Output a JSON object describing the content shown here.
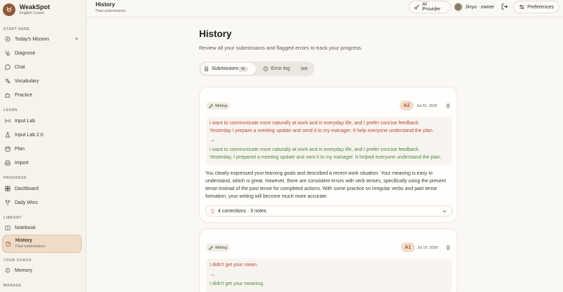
{
  "brand": {
    "name": "WeakSpot",
    "subtitle": "English Coach",
    "logo": "WS"
  },
  "sidebar": {
    "sections": {
      "start": "START HERE",
      "learn": "LEARN",
      "progress": "PROGRESS",
      "library": "LIBRARY",
      "coach": "YOUR COACH",
      "manage": "MANAGE"
    },
    "items": {
      "mission": {
        "label": "Today's Mission",
        "icon": "compass-icon"
      },
      "diagnose": {
        "label": "Diagnose",
        "icon": "stethoscope-icon"
      },
      "chat": {
        "label": "Chat",
        "icon": "chat-bubble-icon"
      },
      "vocabulary": {
        "label": "Vocabulary",
        "icon": "translate-icon"
      },
      "practice": {
        "label": "Practice",
        "icon": "puzzle-icon"
      },
      "input_lab": {
        "label": "Input Lab",
        "icon": "radio-waves-icon"
      },
      "input_lab2": {
        "label": "Input Lab 2.0",
        "icon": "flask-icon"
      },
      "plan": {
        "label": "Plan",
        "icon": "calendar-icon"
      },
      "import": {
        "label": "Import",
        "icon": "inbox-icon"
      },
      "dashboard": {
        "label": "Dashboard",
        "icon": "grid-icon"
      },
      "daily_wins": {
        "label": "Daily Wins",
        "icon": "trophy-icon"
      },
      "notebook": {
        "label": "Notebook",
        "icon": "book-icon"
      },
      "history": {
        "label": "History",
        "sublabel": "Past submissions",
        "icon": "history-icon"
      },
      "memory": {
        "label": "Memory",
        "icon": "brain-icon"
      }
    }
  },
  "topbar": {
    "title": "History",
    "subtitle": "Past submissions",
    "ai_provider": "AI Provider",
    "user": "Jinyu · owner",
    "preferences": "Preferences"
  },
  "main": {
    "title": "History",
    "description": "Review all your submissions and flagged errors to track your progress.",
    "tabs": {
      "submissions": {
        "label": "Submissions",
        "count": "41"
      },
      "error_log": {
        "label": "Error log",
        "count": "508"
      }
    },
    "cards": [
      {
        "type": "Writing",
        "level": "A2",
        "date": "Jul 20, 2026",
        "original_1": "I want to communicate more naturally at work and in everyday life, and I prefer concise feedback.",
        "original_2": "Yesterday I prepare a meeting update and send it to my manager. It help everyone understand the plan.",
        "arrow": "→",
        "corrected_1": "I want to communicate more naturally at work and in everyday life, and I prefer concise feedback.",
        "corrected_2": "Yesterday, I prepared a meeting update and sent it to my manager. It helped everyone understand the plan.",
        "feedback": "You clearly expressed your learning goals and described a recent work situation. Your meaning is easy to understand, which is great. However, there are consistent errors with verb tenses, specifically using the present tense instead of the past tense for completed actions. With some practice on irregular verbs and past tense formation, your writing will become much more accurate.",
        "corrections_summary": "4 corrections · 3 notes"
      },
      {
        "type": "Writing",
        "level": "A1",
        "date": "Jul 19, 2026",
        "original_1": "I didn't get your mean.",
        "arrow": "→",
        "corrected_1": "I didn't get your meaning."
      }
    ]
  },
  "colors": {
    "accent": "#a8562b",
    "error": "#c0463a",
    "correct": "#4f8a3f",
    "active_nav": "#efdcc8"
  }
}
